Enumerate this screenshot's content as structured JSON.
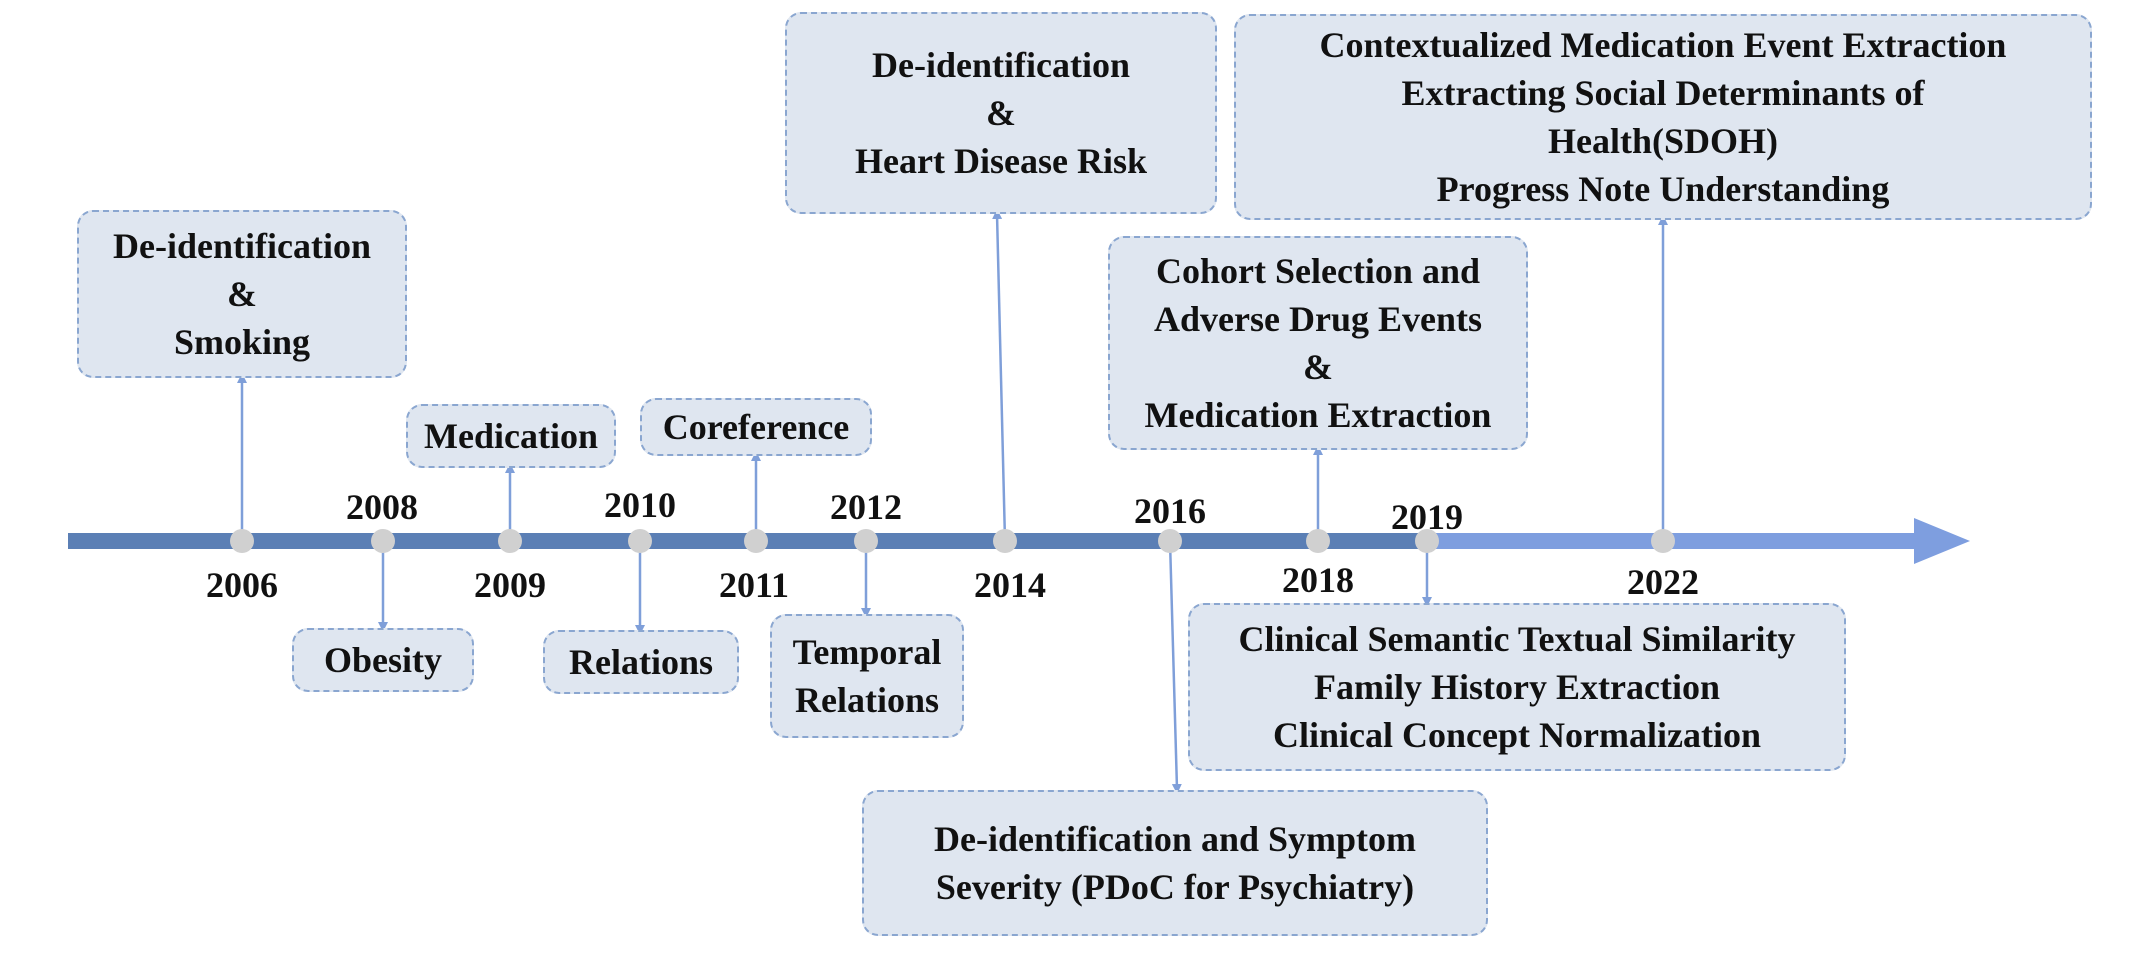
{
  "timeline": {
    "colors": {
      "axis_primary": "#5b7fb5",
      "axis_recent": "#7e9edf",
      "dot": "#d0d0d0",
      "connector": "#7f9fd9",
      "box_fill": "#dfe6f0",
      "box_border": "#8aa6d0"
    },
    "years": [
      {
        "label": "2006"
      },
      {
        "label": "2008"
      },
      {
        "label": "2009"
      },
      {
        "label": "2010"
      },
      {
        "label": "2011"
      },
      {
        "label": "2012"
      },
      {
        "label": "2014"
      },
      {
        "label": "2016"
      },
      {
        "label": "2018"
      },
      {
        "label": "2019"
      },
      {
        "label": "2022"
      }
    ],
    "events": [
      {
        "year": "2006",
        "lines": [
          "De-identification",
          "&",
          "Smoking"
        ]
      },
      {
        "year": "2008",
        "lines": [
          "Obesity"
        ]
      },
      {
        "year": "2009",
        "lines": [
          "Medication"
        ]
      },
      {
        "year": "2010",
        "lines": [
          "Relations"
        ]
      },
      {
        "year": "2011",
        "lines": [
          "Coreference"
        ]
      },
      {
        "year": "2012",
        "lines": [
          "Temporal",
          "Relations"
        ]
      },
      {
        "year": "2014",
        "lines": [
          "De-identification",
          "&",
          "Heart Disease Risk"
        ]
      },
      {
        "year": "2016",
        "lines": [
          "De-identification and Symptom",
          "Severity (PDoC for Psychiatry)"
        ]
      },
      {
        "year": "2018",
        "lines": [
          "Cohort Selection and",
          "Adverse Drug Events",
          "&",
          "Medication Extraction"
        ]
      },
      {
        "year": "2019",
        "lines": [
          "Clinical Semantic Textual Similarity",
          "Family History Extraction",
          "Clinical Concept Normalization"
        ]
      },
      {
        "year": "2022",
        "lines": [
          "Contextualized Medication Event Extraction",
          "Extracting Social Determinants of",
          "Health(SDOH)",
          "Progress Note Understanding"
        ]
      }
    ]
  }
}
